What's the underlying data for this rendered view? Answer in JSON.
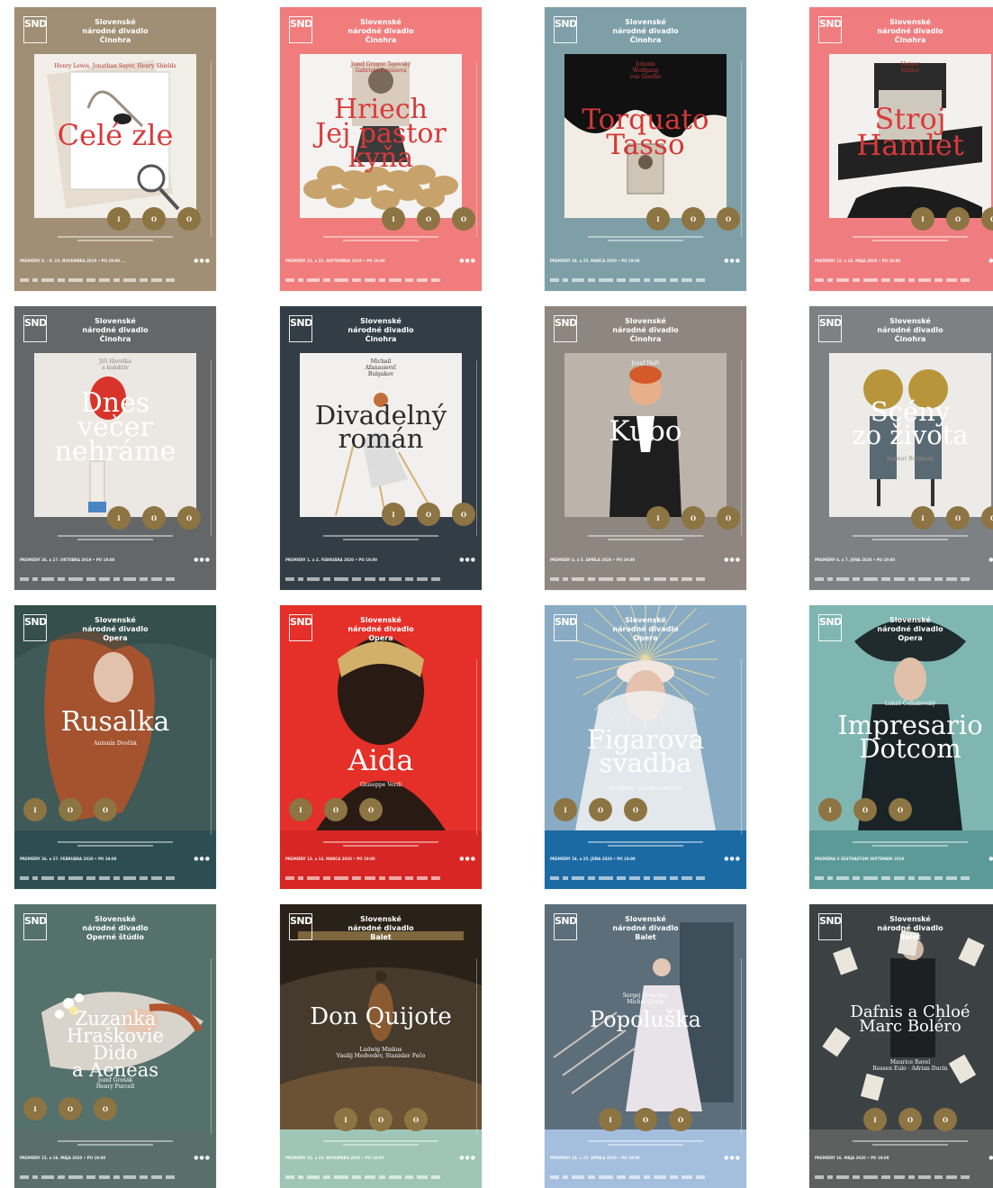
{
  "colors": {
    "gold": "#8d7443",
    "title_red": "#d93a3a"
  },
  "logo_text": "SND",
  "posters": [
    {
      "org": [
        "Slovenské",
        "národné divadlo",
        "Činohra"
      ],
      "authors": "Henry Lewis, Jonathan Sayer, Henry Shields",
      "title": "Celé zle",
      "circles": [
        "I",
        "O",
        "O"
      ],
      "premiere": "PREMIÉRY 8. - 9. 10. NOVEMBRA 2019 • PO 19:00 ...",
      "bg": "#a08f74"
    },
    {
      "org": [
        "Slovenské",
        "národné divadlo",
        "Činohra"
      ],
      "authors": "Jozef Gregor Tajovský\nGabriela Preissová",
      "title": "Hriech\nJej pastor\nkyňa",
      "circles": [
        "I",
        "O",
        "O"
      ],
      "premiere": "PREMIÉRY 21. a 22. SEPTEMBRA 2019 • PO 19:00",
      "bg": "#f07d7c"
    },
    {
      "org": [
        "Slovenské",
        "národné divadlo",
        "Činohra"
      ],
      "authors": "Johann\nWolfgang\nvon Goethe",
      "title": "Torquato\nTasso",
      "circles": [
        "I",
        "O",
        "O"
      ],
      "premiere": "PREMIÉRY 24. a 25. MARCA 2020 • PO 19:00",
      "bg": "#7e9fa8"
    },
    {
      "org": [
        "Slovenské",
        "národné divadlo",
        "Činohra"
      ],
      "authors": "Heiner\nMüller",
      "title": "Stroj\nHamlet",
      "circles": [
        "I",
        "O",
        "O"
      ],
      "premiere": "PREMIÉRY 15. a 16. MÁJA 2020 • PO 19:00",
      "bg": "#ef7d80"
    },
    {
      "org": [
        "Slovenské",
        "národné divadlo",
        "Činohra"
      ],
      "authors": "Jiří Havelka\na kolektív",
      "title": "Dnes\nvečer\nnehráme",
      "circles": [
        "I",
        "O",
        "O"
      ],
      "premiere": "PREMIÉRY 26. a 27. OKTÓBRA 2019 • PO 19:00",
      "bg": "#646767"
    },
    {
      "org": [
        "Slovenské",
        "národné divadlo",
        "Činohra"
      ],
      "authors": "Michail\nAfanasievič\nBulgakov",
      "title": "Divadelný\nromán",
      "circles": [
        "I",
        "O",
        "O"
      ],
      "premiere": "PREMIÉRY 1. a 2. FEBRUÁRA 2020 • PO 19:00",
      "bg": "#333d45"
    },
    {
      "org": [
        "Slovenské",
        "národné divadlo",
        "Činohra"
      ],
      "authors": "Jozef Heřt",
      "title": "Kubo",
      "circles": [
        "I",
        "O",
        "O"
      ],
      "premiere": "PREMIÉRY 4. a 5. APRÍLA 2020 • PO 19:00",
      "bg": "#8f867f"
    },
    {
      "org": [
        "Slovenské",
        "národné divadlo",
        "Činohra"
      ],
      "authors": "Ingmar Bergman",
      "title": "Scény\nzo života",
      "circles": [
        "I",
        "O",
        "O"
      ],
      "premiere": "PREMIÉRY 6. a 7. JÚNA 2020 • PO 19:00",
      "bg": "#7d8183"
    },
    {
      "org": [
        "Slovenské",
        "národné divadlo",
        "Opera"
      ],
      "authors": "Antonín Dvořák",
      "title": "Rusalka",
      "circles": [
        "I",
        "O",
        "O"
      ],
      "premiere": "PREMIÉRY 26. a 27. FEBRUÁRA 2020 • PO 19:00",
      "bg": "#2c4e52"
    },
    {
      "org": [
        "Slovenské",
        "národné divadlo",
        "Opera"
      ],
      "authors": "Giuseppe Verdi",
      "title": "Aida",
      "circles": [
        "I",
        "O",
        "O"
      ],
      "premiere": "PREMIÉRY 13. a 14. MARCA 2020 • PO 19:00",
      "bg": "#d72624"
    },
    {
      "org": [
        "Slovenské",
        "národné divadlo",
        "Opera"
      ],
      "authors": "Wolfgang Amadeus Mozart",
      "title": "Figarova\nsvadba",
      "circles": [
        "I",
        "O",
        "O"
      ],
      "premiere": "PREMIÉRY 24. a 25. JÚNA 2020 • PO 19:00",
      "bg": "#1c6aa4"
    },
    {
      "org": [
        "Slovenské",
        "národné divadlo",
        "Opera"
      ],
      "authors": "Lukáš Čeliakovský",
      "title": "Impresario\nDotcom",
      "circles": [
        "I",
        "O",
        "O"
      ],
      "premiere": "PREMIÉRA V ŠESTNÁSTOM SEPTEMBRI 2019",
      "bg": "#5b9a98"
    },
    {
      "org": [
        "Slovenské",
        "národné divadlo",
        "Operné štúdio"
      ],
      "authors": "Jozef Grešák\nHenry Purcell",
      "title": "Zuzanka\nHraškovie\nDido\na Aeneas",
      "circles": [
        "I",
        "O",
        "O"
      ],
      "premiere": "PREMIÉRY 15. a 16. MÁJA 2020 • PO 19:00",
      "bg": "#5a6f6b"
    },
    {
      "org": [
        "Slovenské",
        "národné divadlo",
        "Balet"
      ],
      "authors": "Ludwig Minkus\nVasilij Medvedev, Stanislav Fečo",
      "title": "Don Quijote",
      "circles": [
        "I",
        "O",
        "O"
      ],
      "premiere": "PREMIÉRY 22. a 23. NOVEMBRA 2019 • PO 19:00",
      "bg": "#9ec5b5"
    },
    {
      "org": [
        "Slovenské",
        "národné divadlo",
        "Balet"
      ],
      "authors": "Sergej Prokofiev\nMichal Ciccia",
      "title": "Popoluška",
      "circles": [
        "I",
        "O",
        "O"
      ],
      "premiere": "PREMIÉRY 24. a 25. APRÍLA 2020 • PO 19:00",
      "bg": "#a4bede"
    },
    {
      "org": [
        "Slovenské",
        "národné divadlo",
        "Balet"
      ],
      "authors": "Maurice Ravel\nRossen Eulo · Adrian Ducin",
      "title": "Dafnis a Chloé\nMarc Boléro",
      "circles": [
        "I",
        "O",
        "O"
      ],
      "premiere": "PREMIÉRY 16. MÁJA 2020 • PO 19:00",
      "bg": "#5e5f5f"
    }
  ]
}
